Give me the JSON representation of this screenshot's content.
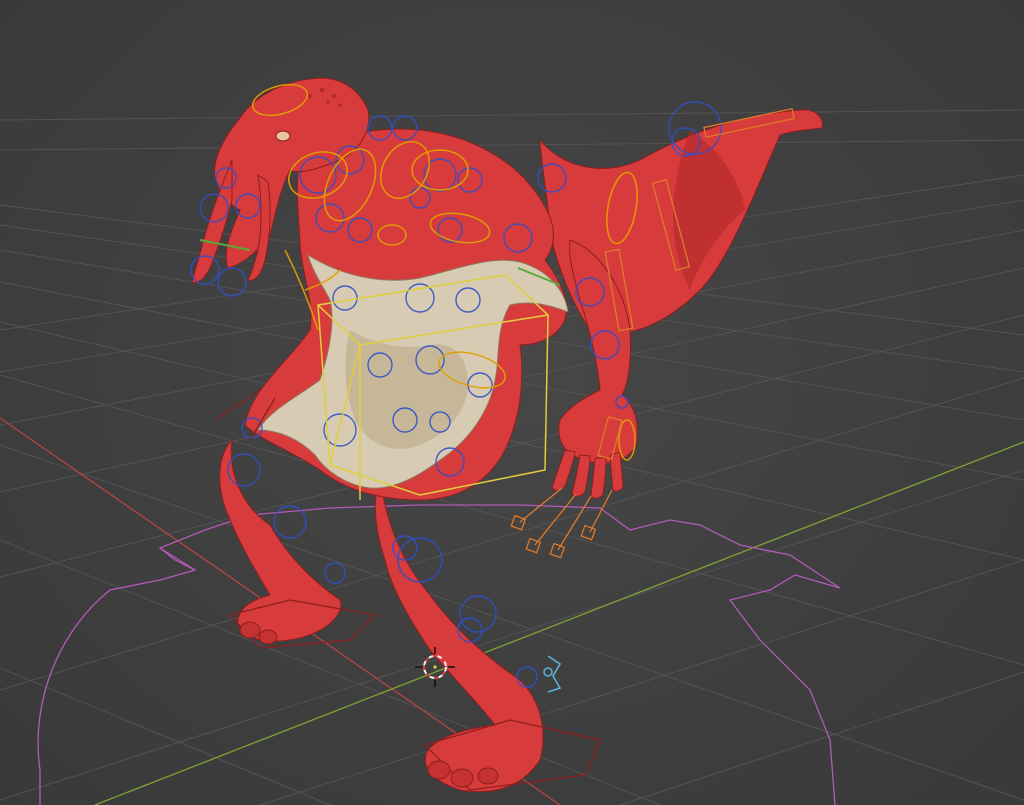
{
  "viewport": {
    "mode": "3d-viewport",
    "background": "#3d3d3d",
    "grid_color": "#575757",
    "x_axis_color": "#b34545",
    "y_axis_color": "#7fa232"
  },
  "character": {
    "body_color": "#d73b3b",
    "body_shade": "#b12a2a",
    "body_dark": "#8e1f1f",
    "belly_color": "#d7cbb3",
    "belly_shade": "#bfae8f"
  },
  "rig": {
    "deform_bone_color": "#3050c8",
    "fk_control_color": "#e1a000",
    "ik_control_color": "#e07a2a",
    "pole_target_color": "#e0cf3a",
    "root_curve_color": "#b25ab8",
    "pivot_color": "#5bb2d6",
    "face_control_color": "#5aa83a"
  },
  "cursor": {
    "type": "3d-cursor",
    "color_a": "#e23a3a",
    "color_b": "#f2f2f2"
  }
}
